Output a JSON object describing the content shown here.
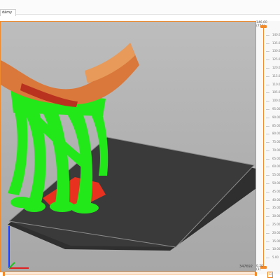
{
  "tab": {
    "label": "dámy"
  },
  "viewport": {
    "layer_counter": "347692",
    "colors": {
      "background": "#b3b3b3",
      "bed": "#2f2f2f",
      "support": "#22e81a",
      "model_top": "#d9783a",
      "raft": "#e8321f"
    }
  },
  "slider": {
    "top_label": "146.60\n(774)",
    "bottom_label": "0.20\n(1)",
    "ticks": [
      "140.00",
      "135.00",
      "130.00",
      "125.00",
      "120.00",
      "115.00",
      "110.00",
      "105.00",
      "100.00",
      "95.00",
      "90.00",
      "85.00",
      "80.00",
      "75.00",
      "70.00",
      "65.00",
      "60.00",
      "55.00",
      "50.00",
      "45.00",
      "40.00",
      "35.00",
      "30.00",
      "25.00",
      "20.00",
      "15.00",
      "10.00",
      "5.00"
    ],
    "one_layer_icon": "one-layer-icon"
  },
  "icons": {
    "axes": "axes-icon"
  }
}
